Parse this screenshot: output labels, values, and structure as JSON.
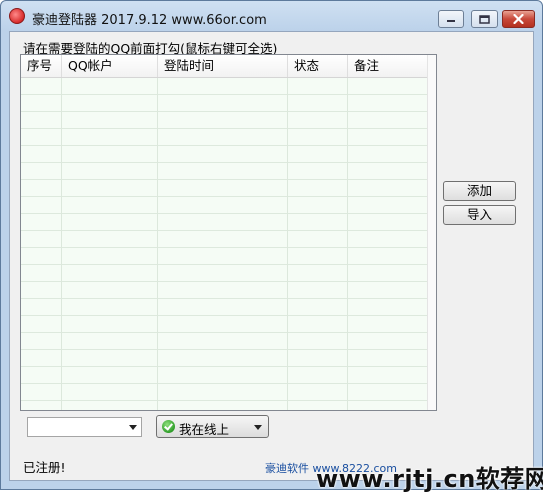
{
  "window": {
    "title": "豪迪登陆器 2017.9.12   www.66or.com"
  },
  "prompt": "请在需要登陆的QQ前面打勾(鼠标右键可全选)",
  "grid": {
    "columns": [
      "序号",
      "QQ帐户",
      "登陆时间",
      "状态",
      "备注"
    ]
  },
  "buttons": {
    "add": "添加",
    "import": "导入"
  },
  "status_select": {
    "value": "我在线上"
  },
  "combo": {
    "value": ""
  },
  "registered_text": "已注册!",
  "footer_link": "豪迪软件 www.8222.com",
  "watermark": "www.rjtj.cn软荐网"
}
